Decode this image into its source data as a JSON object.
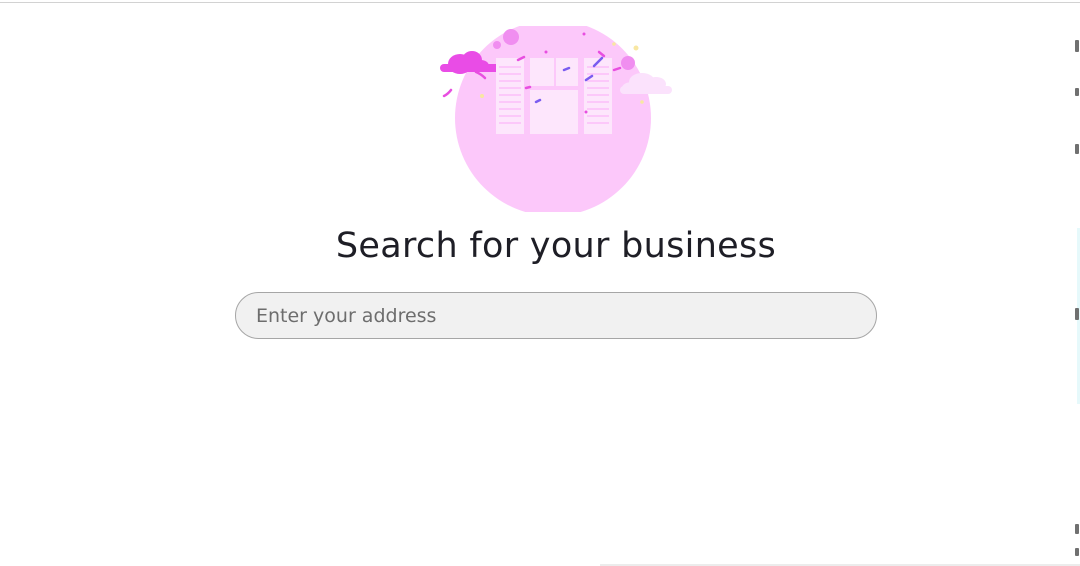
{
  "header": {
    "title": "Search for your business"
  },
  "search": {
    "placeholder": "Enter your address",
    "value": ""
  },
  "illustration": {
    "icon": "storefront-illustration-icon",
    "colors": {
      "circle": "#fcc8fa",
      "building": "#fde6fc",
      "cloud_left": "#e94ce6",
      "cloud_right": "#fbe2fc",
      "confetti_pink": "#e84ee0",
      "confetti_purple": "#7a5cf0",
      "confetti_yellow": "#f8e7a2"
    }
  },
  "theme": {
    "background": "#ffffff",
    "title_color": "#1e1e26",
    "input_background": "#f1f1f1",
    "input_border": "#a6a6a6"
  }
}
